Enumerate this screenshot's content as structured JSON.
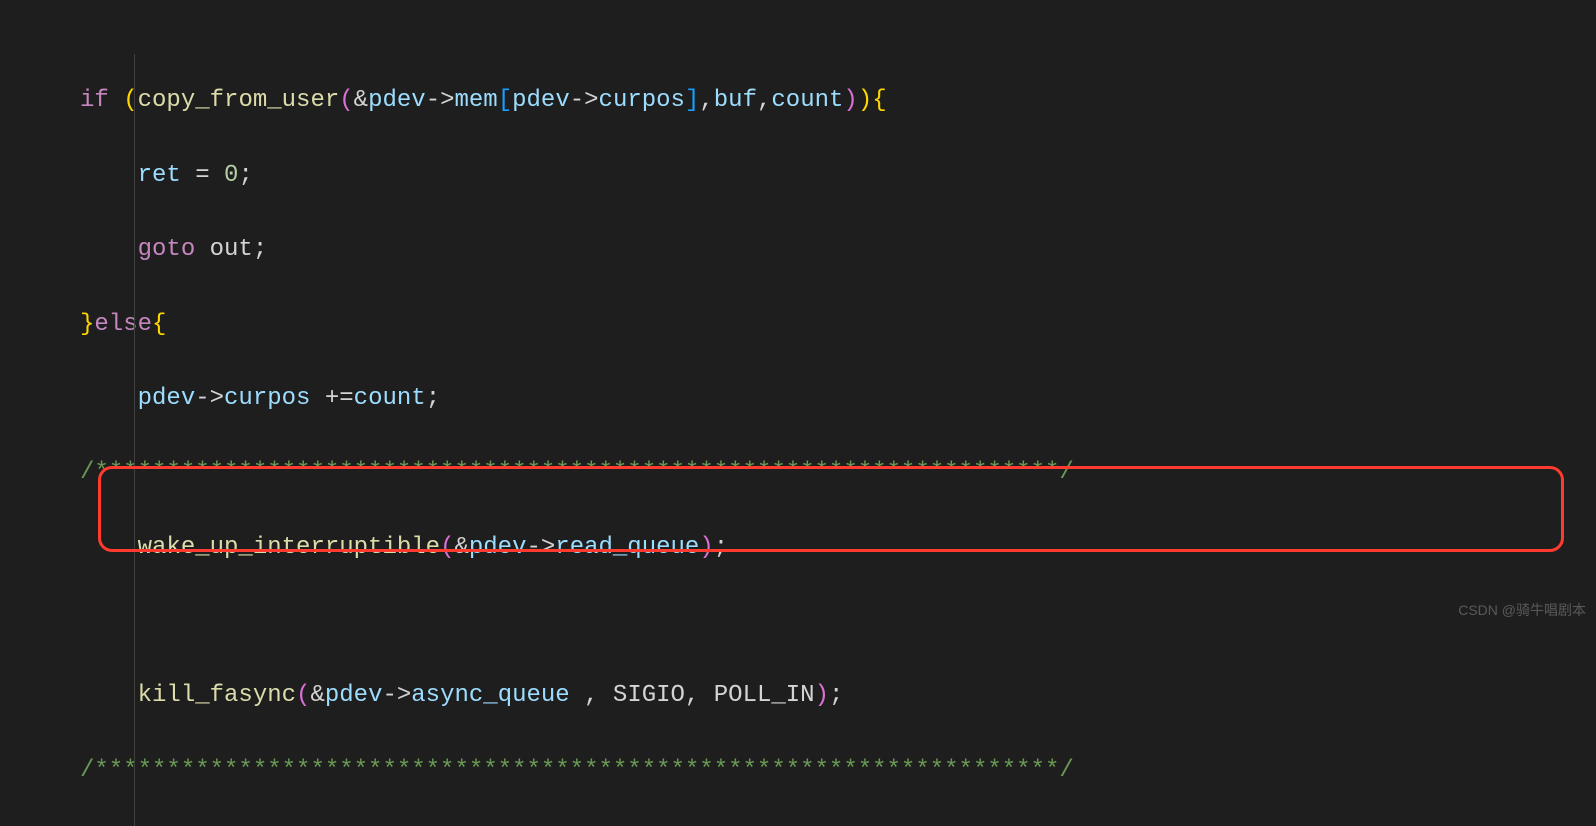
{
  "code": {
    "line1": {
      "if": "if",
      "sp1": " ",
      "op1": "(",
      "fn": "copy_from_user",
      "op2": "(",
      "amp": "&",
      "v1": "pdev",
      "arrow1": "->",
      "m1": "mem",
      "ob": "[",
      "v2": "pdev",
      "arrow2": "->",
      "m2": "curpos",
      "cb": "]",
      "c1": ",",
      "v3": "buf",
      "c2": ",",
      "v4": "count",
      "cp2": ")",
      "cp1": ")",
      "brace": "{"
    },
    "line2": {
      "indent": "    ",
      "v": "ret",
      "sp": " ",
      "eq": "=",
      "sp2": " ",
      "n": "0",
      "semi": ";"
    },
    "line3": {
      "indent": "    ",
      "goto": "goto",
      "sp": " ",
      "lbl": "out",
      "semi": ";"
    },
    "line4": {
      "cb": "}",
      "else": "else",
      "ob": "{"
    },
    "line5": {
      "indent": "    ",
      "v1": "pdev",
      "arrow": "->",
      "m": "curpos",
      "sp": " ",
      "op": "+=",
      "v2": "count",
      "semi": ";"
    },
    "line6": {
      "c": "/*******************************************************************/"
    },
    "line7": {
      "indent": "    ",
      "fn": "wake_up_interruptible",
      "op": "(",
      "amp": "&",
      "v": "pdev",
      "arrow": "->",
      "m": "read_queue",
      "cp": ")",
      "semi": ";"
    },
    "line9": {
      "indent": "    ",
      "fn": "kill_fasync",
      "op": "(",
      "amp": "&",
      "v": "pdev",
      "arrow": "->",
      "m": "async_queue",
      "sp": " ",
      "c1": ",",
      "a2": " SIGIO",
      "c2": ",",
      "a3": " POLL_IN",
      "cp": ")",
      "semi": ";"
    },
    "line10": {
      "c": "/*******************************************************************/"
    }
  },
  "watermark": "CSDN @骑牛唱剧本"
}
